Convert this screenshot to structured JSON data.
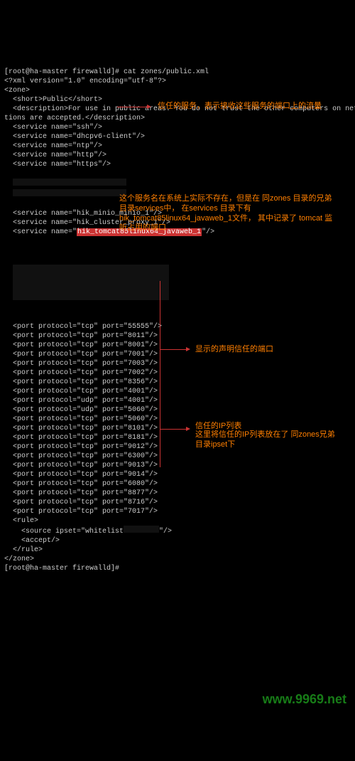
{
  "prompt": "[root@ha-master firewalld]# cat zones/public.xml",
  "xml_decl": "<?xml version=\"1.0\" encoding=\"utf-8\"?>",
  "zone_open": "<zone>",
  "short": "  <short>Public</short>",
  "desc": "  <description>For use in public areas. You do not trust the other computers on networks to not\ntions are accepted.</description>",
  "top_services": [
    "  <service name=\"ssh\"/>",
    "  <service name=\"dhcpv6-client\"/>",
    "  <service name=\"ntp\"/>",
    "  <service name=\"http\"/>",
    "  <service name=\"https\"/>"
  ],
  "mid_services": [
    "  <service name=\"hik_minio_minio_1\"/>",
    "  <service name=\"hik_cluster_proxy_1\"/>"
  ],
  "hl_service_pre": "  <service name=\"",
  "hl_service_val": "hik_tomcat85linux64_javaweb_1",
  "hl_service_post": "\"/>",
  "ports": [
    {
      "proto": "tcp",
      "port": "55555"
    },
    {
      "proto": "tcp",
      "port": "8011"
    },
    {
      "proto": "tcp",
      "port": "8001"
    },
    {
      "proto": "tcp",
      "port": "7001"
    },
    {
      "proto": "tcp",
      "port": "7003"
    },
    {
      "proto": "tcp",
      "port": "7002"
    },
    {
      "proto": "tcp",
      "port": "8356"
    },
    {
      "proto": "tcp",
      "port": "4001"
    },
    {
      "proto": "udp",
      "port": "4001"
    },
    {
      "proto": "udp",
      "port": "5060"
    },
    {
      "proto": "tcp",
      "port": "5060"
    },
    {
      "proto": "tcp",
      "port": "8101"
    },
    {
      "proto": "tcp",
      "port": "8181"
    },
    {
      "proto": "tcp",
      "port": "9012"
    },
    {
      "proto": "tcp",
      "port": "6300"
    },
    {
      "proto": "tcp",
      "port": "9013"
    },
    {
      "proto": "tcp",
      "port": "9014"
    },
    {
      "proto": "tcp",
      "port": "6080"
    },
    {
      "proto": "tcp",
      "port": "8877"
    },
    {
      "proto": "tcp",
      "port": "8716"
    },
    {
      "proto": "tcp",
      "port": "7017"
    }
  ],
  "rule_open": "  <rule>",
  "rule_src_pre": "    <source ipset=\"whitelist",
  "rule_src_post": "\"/>",
  "rule_accept": "    <accept/>",
  "rule_close": "  </rule>",
  "zone_close": "</zone>",
  "end_prompt": "[root@ha-master firewalld]#",
  "anno": {
    "services": "信任的服务，表示接收这些服务的端口上的流量",
    "svc_detail": "这个服务名在系统上实际不存在，但是在\n同zones 目录的兄弟目录services中，\n在services 目录下有 hik_tomcat85linux64_javaweb_1文件，\n其中记录了 tomcat 监听占用的端口",
    "ports": "显示的声明信任的端口",
    "ipset1": "信任的IP列表",
    "ipset2": "这里将信任的IP列表放在了\n同zones兄弟目录ipset下"
  },
  "watermark": "www.9969.net"
}
